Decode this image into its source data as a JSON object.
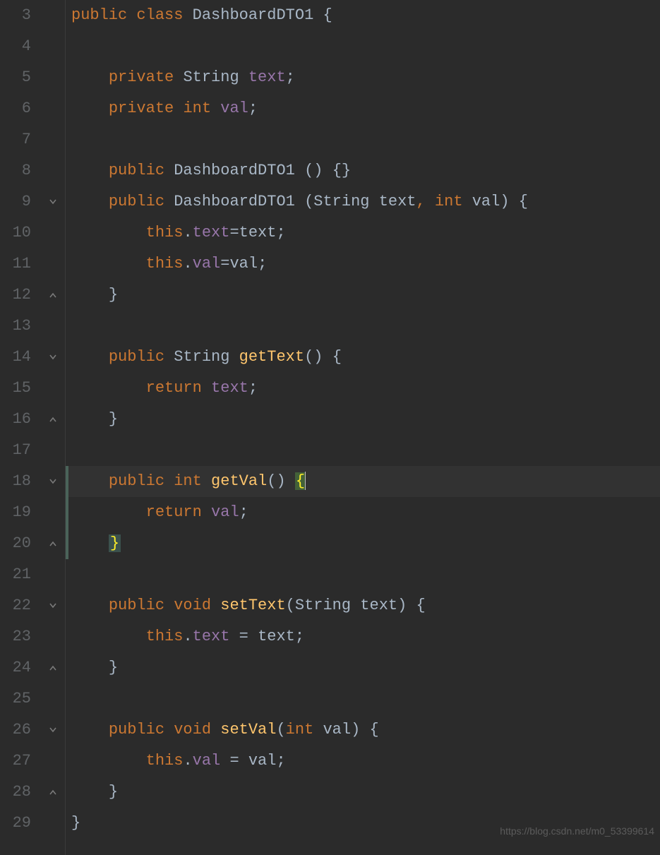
{
  "watermark": "https://blog.csdn.net/m0_53399614",
  "lineNumbers": [
    "3",
    "4",
    "5",
    "6",
    "7",
    "8",
    "9",
    "10",
    "11",
    "12",
    "13",
    "14",
    "15",
    "16",
    "17",
    "18",
    "19",
    "20",
    "21",
    "22",
    "23",
    "24",
    "25",
    "26",
    "27",
    "28",
    "29"
  ],
  "foldMarkers": {
    "9": "open",
    "12": "close",
    "14": "open",
    "16": "close",
    "18": "open",
    "20": "close",
    "22": "open",
    "24": "close",
    "26": "open",
    "28": "close"
  },
  "highlightedLine": "18",
  "changeMarkerLines": [
    "18",
    "19",
    "20"
  ],
  "code": {
    "l3": {
      "indent": "",
      "kw1": "public",
      "sp1": " ",
      "kw2": "class",
      "sp2": " ",
      "cls": "DashboardDTO1",
      "sp3": " ",
      "brace": "{"
    },
    "l5": {
      "indent": "    ",
      "kw": "private",
      "sp1": " ",
      "type": "String",
      "sp2": " ",
      "field": "text",
      "semi": ";"
    },
    "l6": {
      "indent": "    ",
      "kw": "private",
      "sp1": " ",
      "type": "int",
      "sp2": " ",
      "field": "val",
      "semi": ";"
    },
    "l8": {
      "indent": "    ",
      "kw": "public",
      "sp1": " ",
      "cls": "DashboardDTO1",
      "sp2": " ",
      "parens": "()",
      "sp3": " ",
      "braces": "{}"
    },
    "l9": {
      "indent": "    ",
      "kw": "public",
      "sp1": " ",
      "cls": "DashboardDTO1",
      "sp2": " ",
      "lp": "(",
      "t1": "String",
      "sp3": " ",
      "p1": "text",
      "comma": ",",
      "sp4": " ",
      "t2": "int",
      "sp5": " ",
      "p2": "val",
      "rp": ")",
      "sp6": " ",
      "brace": "{"
    },
    "l10": {
      "indent": "        ",
      "kw": "this",
      "dot": ".",
      "field": "text",
      "eq": "=",
      "param": "text",
      "semi": ";"
    },
    "l11": {
      "indent": "        ",
      "kw": "this",
      "dot": ".",
      "field": "val",
      "eq": "=",
      "param": "val",
      "semi": ";"
    },
    "l12": {
      "indent": "    ",
      "brace": "}"
    },
    "l14": {
      "indent": "    ",
      "kw": "public",
      "sp1": " ",
      "type": "String",
      "sp2": " ",
      "method": "getText",
      "parens": "()",
      "sp3": " ",
      "brace": "{"
    },
    "l15": {
      "indent": "        ",
      "kw": "return",
      "sp1": " ",
      "field": "text",
      "semi": ";"
    },
    "l16": {
      "indent": "    ",
      "brace": "}"
    },
    "l18": {
      "indent": "    ",
      "kw": "public",
      "sp1": " ",
      "type": "int",
      "sp2": " ",
      "method": "getVal",
      "parens": "()",
      "sp3": " ",
      "brace": "{"
    },
    "l19": {
      "indent": "        ",
      "kw": "return",
      "sp1": " ",
      "field": "val",
      "semi": ";"
    },
    "l20": {
      "indent": "    ",
      "brace": "}"
    },
    "l22": {
      "indent": "    ",
      "kw": "public",
      "sp1": " ",
      "type": "void",
      "sp2": " ",
      "method": "setText",
      "lp": "(",
      "t1": "String",
      "sp3": " ",
      "p1": "text",
      "rp": ")",
      "sp4": " ",
      "brace": "{"
    },
    "l23": {
      "indent": "        ",
      "kw": "this",
      "dot": ".",
      "field": "text",
      "sp1": " ",
      "eq": "=",
      "sp2": " ",
      "param": "text",
      "semi": ";"
    },
    "l24": {
      "indent": "    ",
      "brace": "}"
    },
    "l26": {
      "indent": "    ",
      "kw": "public",
      "sp1": " ",
      "type": "void",
      "sp2": " ",
      "method": "setVal",
      "lp": "(",
      "t1": "int",
      "sp3": " ",
      "p1": "val",
      "rp": ")",
      "sp4": " ",
      "brace": "{"
    },
    "l27": {
      "indent": "        ",
      "kw": "this",
      "dot": ".",
      "field": "val",
      "sp1": " ",
      "eq": "=",
      "sp2": " ",
      "param": "val",
      "semi": ";"
    },
    "l28": {
      "indent": "    ",
      "brace": "}"
    },
    "l29": {
      "indent": "",
      "brace": "}"
    }
  }
}
